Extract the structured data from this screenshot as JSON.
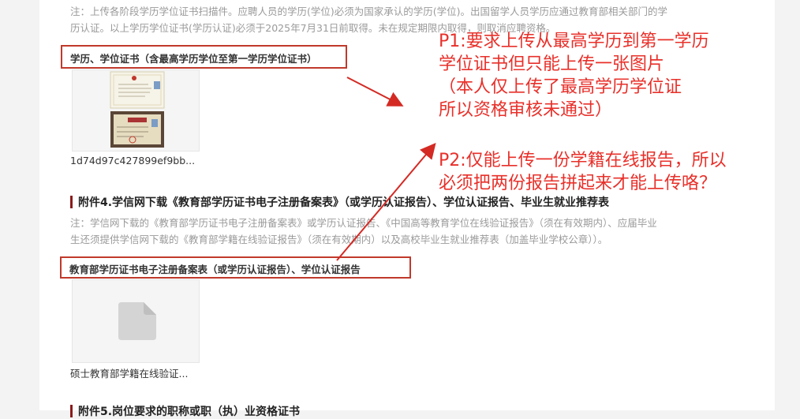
{
  "top_note": {
    "line1": "注：上传各阶段学历学位证书扫描件。应聘人员的学历(学位)必须为国家承认的学历(学位)。出国留学人员学历应通过教育部相关部门的学",
    "line2": "历认证。以上学历学位证书(学历认证)必须于2025年7月31日前取得。未在规定期限内取得，则取消应聘资格。"
  },
  "field1": {
    "label": "学历、学位证书（含最高学历学位至第一学历学位证书）",
    "filename": "1d74d97c427899ef9bb..."
  },
  "section4": {
    "title": "附件4.学信网下载《教育部学历证书电子注册备案表》（或学历认证报告）、学位认证报告、毕业生就业推荐表",
    "note_line1": "注：学信网下载的《教育部学历证书电子注册备案表》或学历认证报告、《中国高等教育学位在线验证报告》（须在有效期内）、应届毕业",
    "note_line2": "生还须提供学信网下载的《教育部学籍在线验证报告》（须在有效期内）以及高校毕业生就业推荐表（加盖毕业学校公章））。"
  },
  "field2": {
    "label": "教育部学历证书电子注册备案表（或学历认证报告）、学位认证报告",
    "filename": "硕士教育部学籍在线验证..."
  },
  "section5": {
    "title": "附件5.岗位要求的职称或职（执）业资格证书"
  },
  "annotations": {
    "p1_line1": "P1:要求上传从最高学历到第一学历",
    "p1_line2": "学位证书但只能上传一张图片",
    "p1_line3": "（本人仅上传了最高学历学位证",
    "p1_line4": "所以资格审核未通过）",
    "p2_line1": "P2:仅能上传一份学籍在线报告，所以",
    "p2_line2": "必须把两份报告拼起来才能上传咯？",
    "color": "#e8302a"
  }
}
